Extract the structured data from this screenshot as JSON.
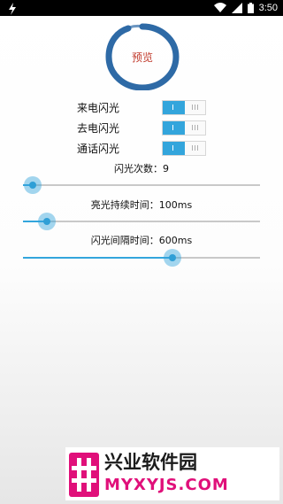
{
  "status_bar": {
    "time": "3:50",
    "icons": [
      "flash-icon",
      "wifi-icon",
      "signal-icon",
      "battery-icon"
    ]
  },
  "preview": {
    "label": "预览",
    "ring_color": "#2e6aa6"
  },
  "toggles": [
    {
      "label": "来电闪光",
      "on": true
    },
    {
      "label": "去电闪光",
      "on": true
    },
    {
      "label": "通话闪光",
      "on": true
    }
  ],
  "sliders": [
    {
      "label": "闪光次数：9",
      "level_percent": 4
    },
    {
      "label": "亮光持续时间：100ms",
      "level_percent": 10
    },
    {
      "label": "闪光间隔时间：600ms",
      "level_percent": 63
    }
  ],
  "watermark": {
    "title": "兴业软件园",
    "domain": "MYXYJS.COM",
    "logo_color": "#e0107a"
  },
  "colors": {
    "accent": "#33a5dc"
  }
}
